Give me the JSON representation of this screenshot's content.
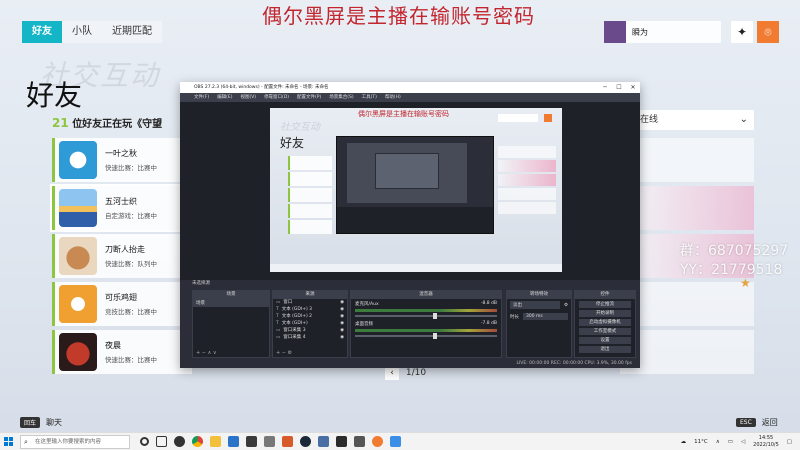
{
  "game": {
    "tabs": [
      {
        "label": "好友",
        "active": true
      },
      {
        "label": "小队",
        "active": false
      },
      {
        "label": "近期匹配",
        "active": false
      }
    ],
    "watermark": "社交互动",
    "page_title": "好友",
    "stream_overlay_text": "偶尔黑屏是主播在输账号密码",
    "friends_count_number": "21",
    "friends_count_text": "位好友正在玩《守望",
    "friends": [
      {
        "name": "一叶之秋",
        "status": "快速比赛：比赛中",
        "avatar_color": "#2e9ad6"
      },
      {
        "name": "五河士织",
        "status": "自定游戏：比赛中",
        "avatar_color": "#5aa0e0"
      },
      {
        "name": "刀断人抬走",
        "status": "快速比赛：队列中",
        "avatar_color": "#b8733a"
      },
      {
        "name": "可乐鸡翅",
        "status": "竞技比赛：比赛中",
        "avatar_color": "#f0a030"
      },
      {
        "name": "夜晨",
        "status": "快速比赛：比赛中",
        "avatar_color": "#8a2a2a"
      }
    ],
    "right_dropdown_label": "在线",
    "profile_name": "瞬为",
    "qq_overlay": [
      "群：687075297",
      "YY：21779518"
    ],
    "pager": "1/10",
    "bottom_left_key": "回车",
    "bottom_left_label": "聊天",
    "bottom_right_key": "ESC",
    "bottom_right_label": "返回",
    "accent_color": "#13b5c6",
    "online_color": "#8cc63f"
  },
  "obs": {
    "title": "OBS 27.2.3 (64-bit, windows) - 配置文件: 未命名 - 场景: 未命名",
    "menu": [
      "文件(F)",
      "编辑(E)",
      "视图(V)",
      "停靠窗口(D)",
      "配置文件(P)",
      "场景集合(S)",
      "工具(T)",
      "帮助(H)"
    ],
    "scene_label": "未选择源",
    "docks": {
      "scenes_title": "场景",
      "sources_title": "来源",
      "mixer_title": "混音器",
      "transitions_title": "转场特效",
      "controls_title": "控件"
    },
    "scenes": [
      "场景"
    ],
    "sources": [
      "窗口",
      "文本 (GDI+) 3",
      "文本 (GDI+) 2",
      "文本 (GDI+)",
      "窗口采集 3",
      "窗口采集 4"
    ],
    "mixer": [
      {
        "name": "麦克风/Aux",
        "db": "-8.8 dB"
      },
      {
        "name": "桌面音频",
        "db": "-7.8 dB"
      }
    ],
    "transition_type": "淡出",
    "transition_duration_label": "时长",
    "transition_duration": "300 ms",
    "controls": [
      "停止推流",
      "开始录制",
      "启动虚拟摄像机",
      "工作室模式",
      "设置",
      "退出"
    ],
    "status": "LIVE: 00:00:00   REC: 00:00:00   CPU: 3.9%, 30.00 fps"
  },
  "taskbar": {
    "search_placeholder": "在这里输入你要搜索的内容",
    "temperature": "11°C",
    "time": "14:55",
    "date": "2022/10/5"
  }
}
